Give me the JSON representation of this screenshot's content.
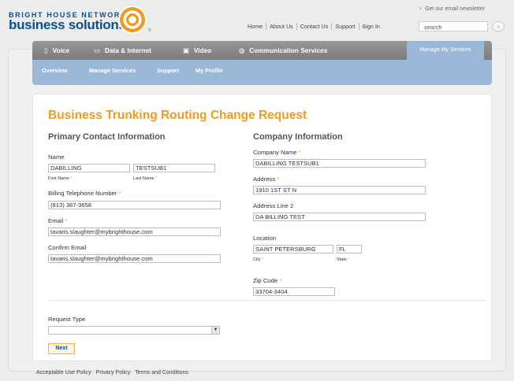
{
  "brand": {
    "top": "BRIGHT HOUSE NETWORKS",
    "bottom": "business solutions",
    "reg": "®"
  },
  "header": {
    "newsletter": "Get our email newsletter",
    "newsletter_arrow": ">",
    "topnav": [
      "Home",
      "About Us",
      "Contact Us",
      "Support",
      "Sign In"
    ],
    "search_placeholder": "search",
    "search_go": "›"
  },
  "mainnav": {
    "items": [
      {
        "icon": "phone-icon",
        "label": "Voice"
      },
      {
        "icon": "monitor-icon",
        "label": "Data & Internet"
      },
      {
        "icon": "tv-icon",
        "label": "Video"
      },
      {
        "icon": "communication-icon",
        "label": "Communication Services"
      }
    ],
    "manage": "Manage My Services"
  },
  "subnav": {
    "items": [
      "Overview",
      "Manage Services",
      "Support",
      "My Profile"
    ]
  },
  "form": {
    "title": "Business Trunking Routing Change Request",
    "primary": {
      "title": "Primary Contact Information",
      "name_label": "Name",
      "first_name": "DABILLING",
      "last_name": "TESTSUB1",
      "first_name_label": "First Name",
      "last_name_label": "Last Name",
      "billing_phone_label": "Billing Telephone Number",
      "billing_phone": "(813) 387-3658",
      "email_label": "Email",
      "email": "tavaris.slaughter@mybrighthouse.com",
      "confirm_email_label": "Confirm Email",
      "confirm_email": "tavaris.slaughter@mybrighthouse.com"
    },
    "company": {
      "title": "Company Information",
      "company_name_label": "Company Name",
      "company_name": "DABILLING TESTSUB1",
      "address_label": "Address",
      "address": "1910 1ST ST N",
      "address2_label": "Address Line 2",
      "address2": "DA BILLING TEST",
      "location_label": "Location",
      "city": "SAINT PETERSBURG",
      "state": "FL",
      "city_label": "City",
      "state_label": "State",
      "zip_label": "Zip Code",
      "zip": "33704-3404"
    },
    "required_mark": "*",
    "request_type_label": "Request Type",
    "request_type_value": "",
    "select_arrow": "▼",
    "next_label": "Next"
  },
  "footer": {
    "links": [
      "Acceptable Use Policy",
      "Privacy Policy",
      "Terms and Conditions"
    ]
  },
  "colors": {
    "brand_blue": "#0d4f8b",
    "accent_orange": "#f29a1f",
    "nav_gray": "#8a8a8a",
    "subnav_blue": "#9cb8d8"
  }
}
